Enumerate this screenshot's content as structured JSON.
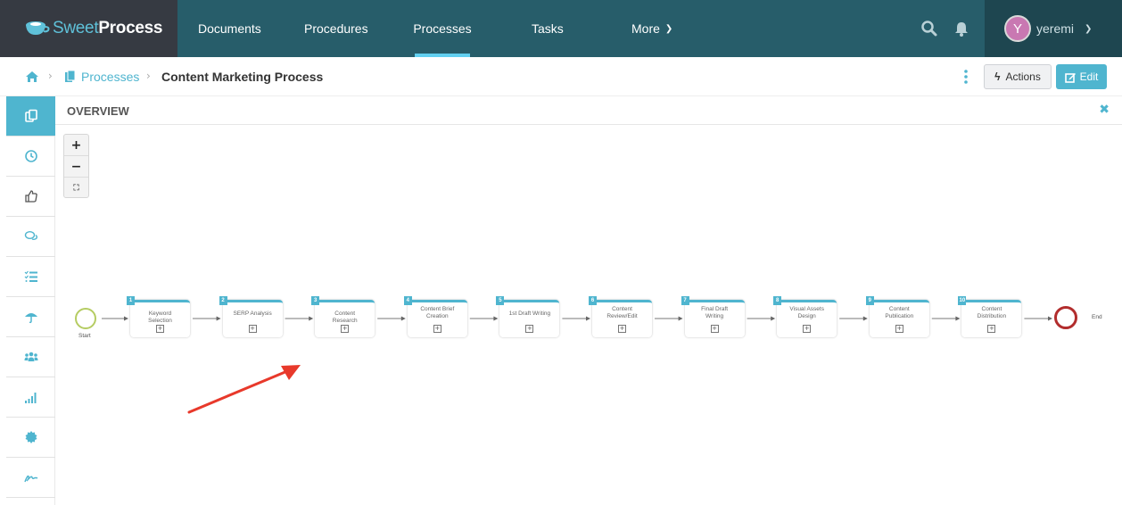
{
  "brand": {
    "part1": "Sweet",
    "part2": "Process"
  },
  "nav": {
    "items": [
      {
        "label": "Documents"
      },
      {
        "label": "Procedures"
      },
      {
        "label": "Processes",
        "active": true
      },
      {
        "label": "Tasks"
      },
      {
        "label": "More"
      }
    ],
    "user": {
      "initial": "Y",
      "name": "yeremi"
    }
  },
  "breadcrumb": {
    "section": "Processes",
    "current": "Content Marketing Process"
  },
  "toolbar": {
    "actions_label": "Actions",
    "edit_label": "Edit"
  },
  "sidebar": {
    "items": [
      "documents-icon",
      "clock-icon",
      "thumbs-up-icon",
      "comments-icon",
      "checklist-icon",
      "umbrella-icon",
      "users-icon",
      "signal-icon",
      "badge-icon",
      "signature-icon"
    ]
  },
  "overview": {
    "title": "OVERVIEW",
    "zoom": {
      "in": "+",
      "out": "−",
      "fit": "⛶"
    },
    "start_label": "Start",
    "end_label": "End",
    "steps": [
      {
        "num": "1",
        "label": "Keyword Selection"
      },
      {
        "num": "2",
        "label": "SERP Analysis"
      },
      {
        "num": "3",
        "label": "Content Research"
      },
      {
        "num": "4",
        "label": "Content Brief Creation"
      },
      {
        "num": "5",
        "label": "1st Draft Writing"
      },
      {
        "num": "6",
        "label": "Content Review/Edit"
      },
      {
        "num": "7",
        "label": "Final Draft Writing"
      },
      {
        "num": "8",
        "label": "Visual Assets Design"
      },
      {
        "num": "9",
        "label": "Content Publication"
      },
      {
        "num": "10",
        "label": "Content Distribution"
      }
    ]
  },
  "colors": {
    "accent": "#4fb5cf",
    "nav_bg": "#275d6a",
    "brand_bg": "#363a42",
    "annotation_arrow": "#e8392b"
  }
}
